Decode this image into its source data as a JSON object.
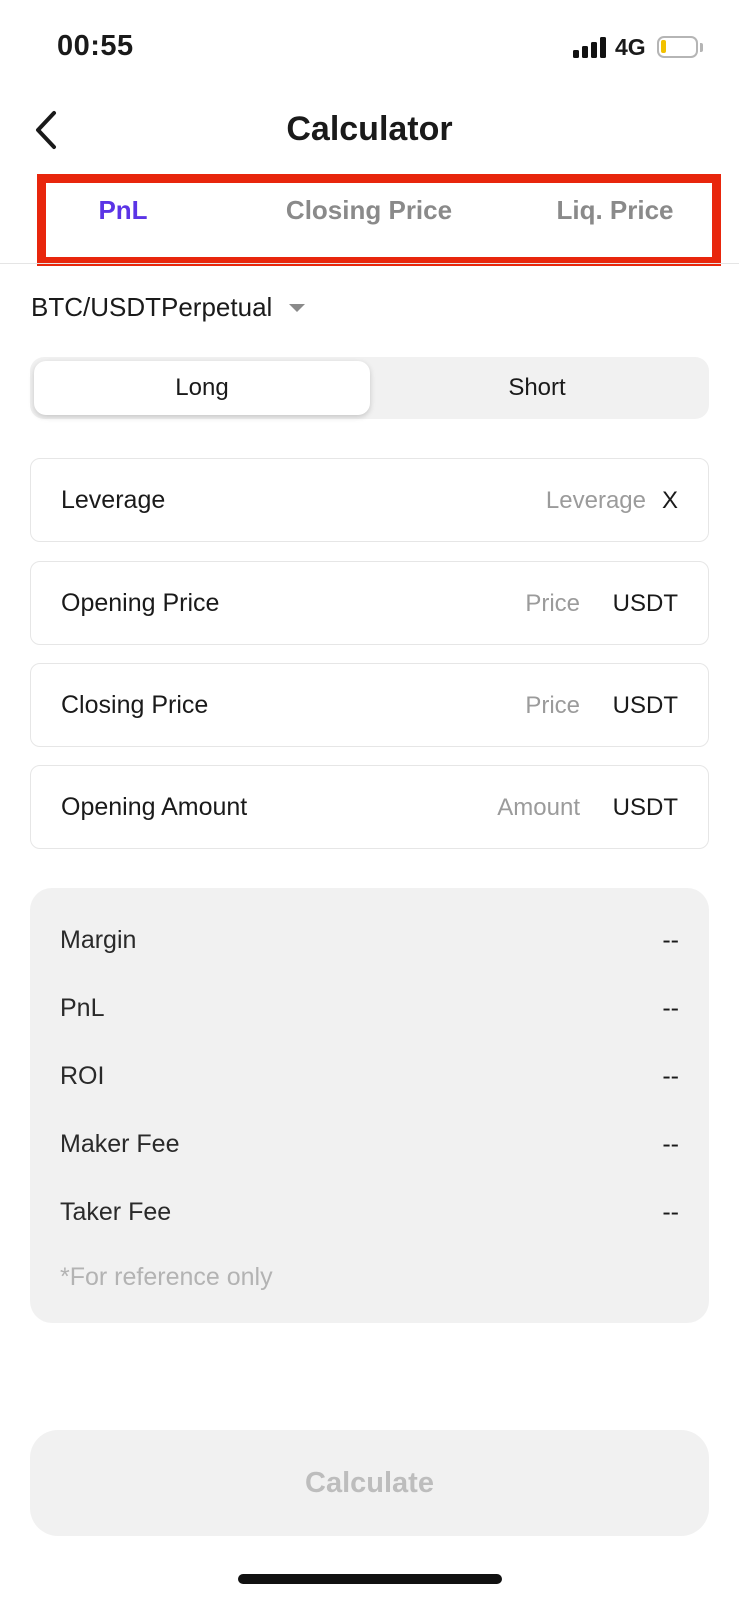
{
  "status_bar": {
    "time": "00:55",
    "network": "4G",
    "battery_color": "#f2c100"
  },
  "header": {
    "title": "Calculator",
    "back_icon": "chevron-left-icon"
  },
  "tabs": [
    {
      "label": "PnL",
      "active": true
    },
    {
      "label": "Closing Price",
      "active": false
    },
    {
      "label": "Liq. Price",
      "active": false
    }
  ],
  "pair": {
    "label": "BTC/USDTPerpetual",
    "icon": "caret-down-icon"
  },
  "direction": {
    "long_label": "Long",
    "short_label": "Short",
    "selected": "Long"
  },
  "fields": [
    {
      "label": "Leverage",
      "placeholder": "Leverage",
      "value": "",
      "unit": "X"
    },
    {
      "label": "Opening Price",
      "placeholder": "Price",
      "value": "",
      "unit": "USDT"
    },
    {
      "label": "Closing Price",
      "placeholder": "Price",
      "value": "",
      "unit": "USDT"
    },
    {
      "label": "Opening Amount",
      "placeholder": "Amount",
      "value": "",
      "unit": "USDT"
    }
  ],
  "results": {
    "rows": [
      {
        "label": "Margin",
        "value": "--"
      },
      {
        "label": "PnL",
        "value": "--"
      },
      {
        "label": "ROI",
        "value": "--"
      },
      {
        "label": "Maker Fee",
        "value": "--"
      },
      {
        "label": "Taker Fee",
        "value": "--"
      }
    ],
    "note": "*For reference only"
  },
  "calculate_label": "Calculate",
  "colors": {
    "accent": "#5b34e6",
    "highlight": "#e8260c",
    "muted": "#8a8a8a"
  }
}
